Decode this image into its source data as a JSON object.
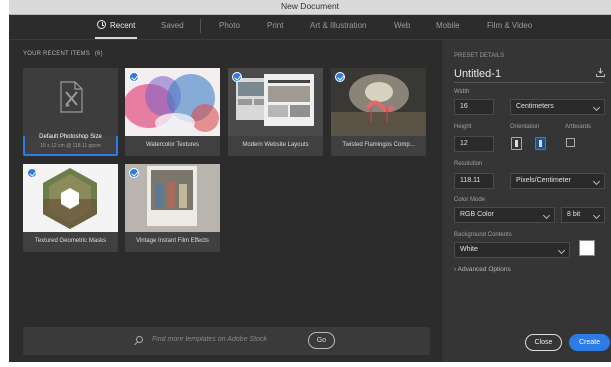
{
  "window": {
    "title": "New Document"
  },
  "tabs": [
    {
      "label": "Recent",
      "active": true
    },
    {
      "label": "Saved"
    },
    {
      "label": "Photo"
    },
    {
      "label": "Print"
    },
    {
      "label": "Art & Illustration"
    },
    {
      "label": "Web"
    },
    {
      "label": "Mobile"
    },
    {
      "label": "Film & Video"
    }
  ],
  "recent": {
    "section_title": "YOUR RECENT ITEMS",
    "count": "(6)",
    "items": [
      {
        "label": "Default Photoshop Size",
        "sublabel": "16 x 12 cm @ 118.11 ppcm",
        "selected": true,
        "checked": false
      },
      {
        "label": "Watercolor Textures",
        "checked": true
      },
      {
        "label": "Modern Website Layouts",
        "checked": true
      },
      {
        "label": "Twisted Flamingos Comp...",
        "checked": true
      },
      {
        "label": "Textured Geometric Masks",
        "checked": true
      },
      {
        "label": "Vintage Instant Film Effects",
        "checked": true
      }
    ]
  },
  "search": {
    "placeholder": "Find more templates on Adobe Stock",
    "go_label": "Go"
  },
  "preset": {
    "header": "PRESET DETAILS",
    "name": "Untitled-1",
    "width_label": "Width",
    "width_value": "16",
    "width_unit": "Centimeters",
    "height_label": "Height",
    "height_value": "12",
    "orientation_label": "Orientation",
    "orientation_selected": "landscape",
    "artboards_label": "Artboards",
    "resolution_label": "Resolution",
    "resolution_value": "118.11",
    "resolution_unit": "Pixels/Centimeter",
    "color_mode_label": "Color Mode",
    "color_mode_value": "RGB Color",
    "bit_depth": "8 bit",
    "bg_label": "Background Contents",
    "bg_value": "White",
    "bg_swatch": "#ffffff",
    "advanced_label": "Advanced Options"
  },
  "actions": {
    "close_label": "Close",
    "create_label": "Create"
  },
  "colors": {
    "accent": "#2d7ce6",
    "panel": "#2c2c2c",
    "side_panel": "#353535"
  }
}
